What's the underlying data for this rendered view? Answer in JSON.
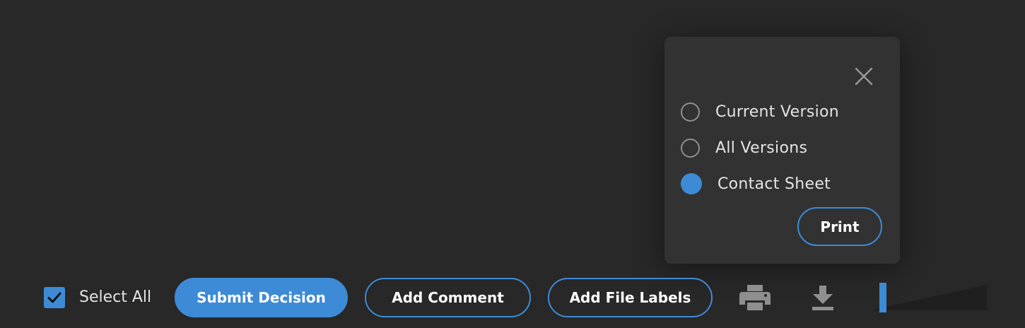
{
  "print_popup": {
    "options": [
      {
        "label": "Current Version",
        "selected": false
      },
      {
        "label": "All Versions",
        "selected": false
      },
      {
        "label": "Contact Sheet",
        "selected": true
      }
    ],
    "print_label": "Print",
    "close_icon": "close-icon"
  },
  "toolbar": {
    "select_all_label": "Select All",
    "select_all_checked": true,
    "submit_label": "Submit Decision",
    "add_comment_label": "Add Comment",
    "add_file_labels_label": "Add File Labels",
    "print_icon": "printer-icon",
    "download_icon": "download-icon"
  },
  "colors": {
    "background": "#282828",
    "popup": "#323232",
    "accent": "#3d8bd6",
    "icon_gray": "#8f8f8f",
    "text": "#e4e4e4"
  }
}
